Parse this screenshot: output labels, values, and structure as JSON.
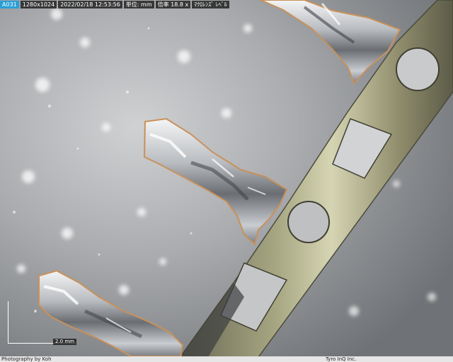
{
  "info_bar": {
    "camera_id": "A031",
    "resolution": "1280x1024",
    "timestamp": "2022/02/18 12:53:56",
    "unit": "単位: mm",
    "magnification": "倍率 18.8 x",
    "mode": "ﾏｸﾛﾚﾝｽﾞ ﾚﾍﾞﾙ"
  },
  "scale_bar": {
    "label": "2.0 mm"
  },
  "credits": {
    "photographer": "Photography by Koh",
    "company": "Tyro InQ Inc."
  },
  "colors": {
    "background_silver": "#9a9c9f",
    "metal_light": "#e4e6e8",
    "metal_dark": "#4a4c4e",
    "copper_edge": "#c8915a",
    "info_accent": "#2a9fd6"
  }
}
